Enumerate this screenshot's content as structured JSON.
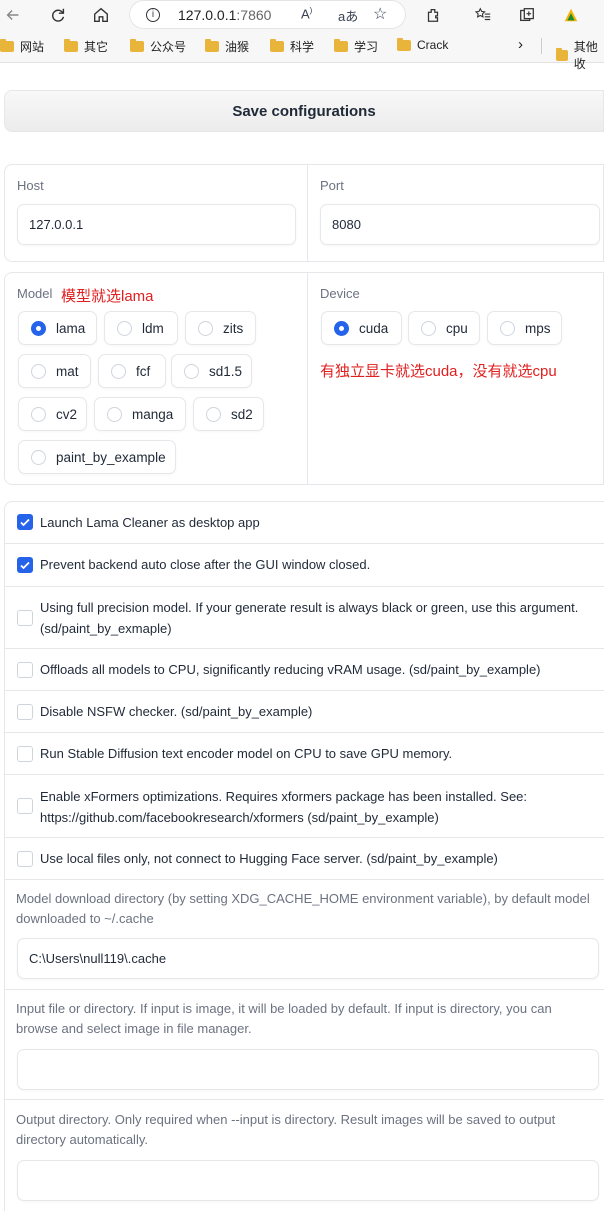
{
  "browser": {
    "url_host": "127.0.0.1",
    "url_port": ":7860",
    "bookmarks": [
      "网站",
      "其它",
      "公众号",
      "油猴",
      "科学",
      "学习",
      "Crack",
      "其他收"
    ]
  },
  "save_button": "Save configurations",
  "host": {
    "label": "Host",
    "value": "127.0.0.1"
  },
  "port": {
    "label": "Port",
    "value": "8080"
  },
  "model": {
    "label": "Model",
    "annotation": "模型就选lama",
    "options": [
      "lama",
      "ldm",
      "zits",
      "mat",
      "fcf",
      "sd1.5",
      "cv2",
      "manga",
      "sd2",
      "paint_by_example"
    ],
    "selected": "lama"
  },
  "device": {
    "label": "Device",
    "annotation": "有独立显卡就选cuda，没有就选cpu",
    "options": [
      "cuda",
      "cpu",
      "mps"
    ],
    "selected": "cuda"
  },
  "checkboxes": [
    {
      "label": "Launch Lama Cleaner as desktop app",
      "checked": true
    },
    {
      "label": "Prevent backend auto close after the GUI window closed.",
      "checked": true
    },
    {
      "label": "Using full precision model. If your generate result is always black or green, use this argument. (sd/paint_by_exmaple)",
      "checked": false
    },
    {
      "label": "Offloads all models to CPU, significantly reducing vRAM usage. (sd/paint_by_example)",
      "checked": false
    },
    {
      "label": "Disable NSFW checker. (sd/paint_by_example)",
      "checked": false
    },
    {
      "label": "Run Stable Diffusion text encoder model on CPU to save GPU memory.",
      "checked": false
    },
    {
      "label": "Enable xFormers optimizations. Requires xformers package has been installed. See: https://github.com/facebookresearch/xformers (sd/paint_by_example)",
      "checked": false
    },
    {
      "label": "Use local files only, not connect to Hugging Face server. (sd/paint_by_example)",
      "checked": false
    }
  ],
  "model_dir": {
    "label": "Model download directory (by setting XDG_CACHE_HOME environment variable), by default model downloaded to ~/.cache",
    "value": "C:\\Users\\null119\\.cache"
  },
  "input_dir": {
    "label": "Input file or directory. If input is image, it will be loaded by default. If input is directory, you can browse and select image in file manager.",
    "value": ""
  },
  "output_dir": {
    "label": "Output directory. Only required when --input is directory. Result images will be saved to output directory automatically.",
    "value": ""
  }
}
